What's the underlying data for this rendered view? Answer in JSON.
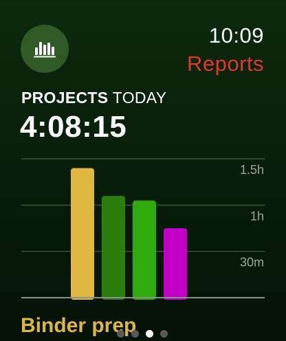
{
  "header": {
    "time": "10:09",
    "screen_title": "Reports",
    "app_icon": "bar-chart-icon"
  },
  "summary": {
    "label_bold": "PROJECTS",
    "label_light": "TODAY",
    "total_time": "4:08:15"
  },
  "chart_data": {
    "type": "bar",
    "categories": [
      "",
      "",
      "",
      ""
    ],
    "values": [
      1.4,
      1.1,
      1.05,
      0.75
    ],
    "colors": [
      "#dfb640",
      "#2b7d0e",
      "#2eaa0c",
      "#c300c9"
    ],
    "y_unit": "hours",
    "ylim": [
      0,
      1.5
    ],
    "yticks": [
      {
        "value": 0.5,
        "label": "30m"
      },
      {
        "value": 1,
        "label": "1h"
      },
      {
        "value": 1.5,
        "label": "1.5h"
      }
    ],
    "grid": true,
    "xlabel": "",
    "ylabel": ""
  },
  "footer": {
    "project_name": "Binder prep",
    "page_indicator": {
      "count": 4,
      "active_index": 2
    }
  },
  "colors": {
    "accent_red": "#e0372f",
    "project_yellow": "#dfb640"
  }
}
